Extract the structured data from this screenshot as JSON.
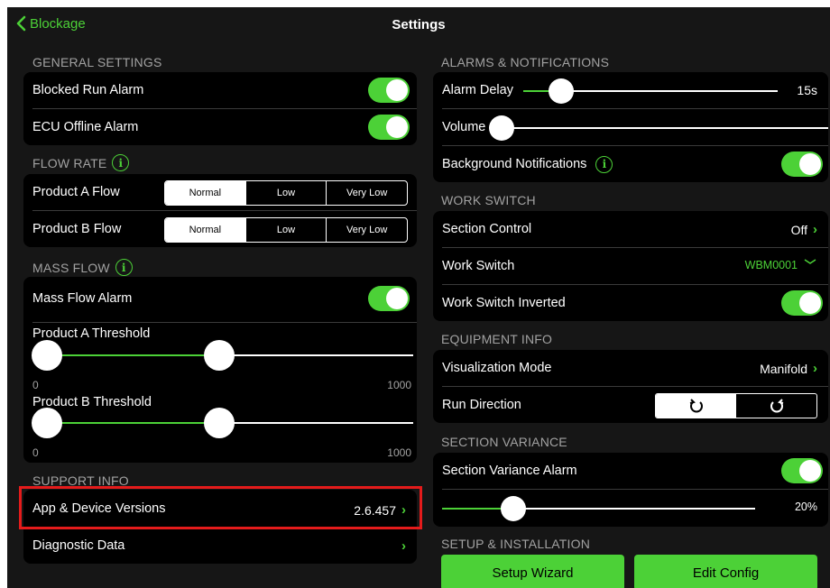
{
  "nav": {
    "back_label": "Blockage",
    "title": "Settings"
  },
  "left": {
    "general": {
      "header": "GENERAL SETTINGS",
      "blocked_run_alarm": "Blocked Run Alarm",
      "ecu_offline_alarm": "ECU Offline Alarm"
    },
    "flow_rate": {
      "header": "FLOW RATE",
      "product_a": "Product A Flow",
      "product_b": "Product B Flow",
      "options": [
        "Normal",
        "Low",
        "Very Low"
      ],
      "selected": "Normal"
    },
    "mass_flow": {
      "header": "MASS FLOW",
      "alarm": "Mass Flow Alarm",
      "a_threshold": "Product A Threshold",
      "b_threshold": "Product B Threshold",
      "min": "0",
      "max": "1000"
    },
    "support": {
      "header": "SUPPORT INFO",
      "app_versions": "App & Device Versions",
      "app_version_value": "2.6.457",
      "diagnostic": "Diagnostic Data"
    }
  },
  "right": {
    "alarms": {
      "header": "ALARMS & NOTIFICATIONS",
      "alarm_delay": "Alarm Delay",
      "alarm_delay_value": "15s",
      "volume": "Volume",
      "background_notifications": "Background Notifications"
    },
    "work_switch": {
      "header": "WORK SWITCH",
      "section_control": "Section Control",
      "section_control_value": "Off",
      "work_switch": "Work Switch",
      "work_switch_value": "WBM0001",
      "inverted": "Work Switch Inverted"
    },
    "equipment": {
      "header": "EQUIPMENT INFO",
      "visualization_mode": "Visualization Mode",
      "visualization_value": "Manifold",
      "run_direction": "Run Direction"
    },
    "variance": {
      "header": "SECTION VARIANCE",
      "alarm": "Section Variance Alarm",
      "value": "20%"
    },
    "setup": {
      "header": "SETUP & INSTALLATION",
      "wizard": "Setup Wizard",
      "edit_config": "Edit Config"
    }
  },
  "colors": {
    "accent": "#4cd137",
    "background": "#161616",
    "card": "#000000",
    "highlight": "#e41b1b"
  }
}
